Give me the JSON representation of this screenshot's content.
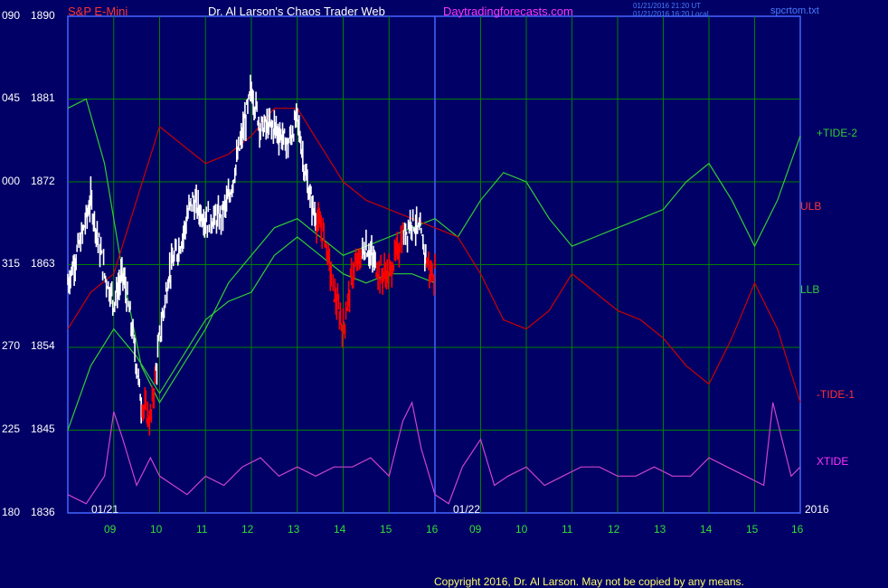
{
  "header": {
    "symbol": "S&P E-Mini",
    "author": "Dr. Al Larson's Chaos Trader Web",
    "site": "Daytradingforecasts.com",
    "stamp_ut": "01/21/2016 21:20 UT",
    "stamp_local": "01/21/2016 16:20 Local",
    "file": "spcrtom.txt"
  },
  "footer": {
    "copyright": "Copyright 2016, Dr. Al Larson. May not be copied by any means."
  },
  "colors": {
    "background": "#000066",
    "grid": "#008000",
    "frame": "#4466ff",
    "price": "#ffffff",
    "price_down": "#ff0000",
    "tide2": "#33cc33",
    "bands": "#cc0000",
    "xtide": "#cc44cc",
    "ma_fast": "#ffff66",
    "ma_mid": "#33ccff",
    "ma_slow": "#33cc33"
  },
  "chart_data": {
    "type": "line",
    "title": "S&P E-Mini",
    "y_left_ticks": [
      "090",
      "045",
      "000",
      "315",
      "270",
      "225",
      "180"
    ],
    "y_right_ticks": [
      1890,
      1881,
      1872,
      1863,
      1854,
      1845,
      1836
    ],
    "ylim": [
      1836,
      1890
    ],
    "x_hours_day1": [
      "09",
      "10",
      "11",
      "12",
      "13",
      "14",
      "15",
      "16"
    ],
    "x_hours_day2": [
      "09",
      "10",
      "11",
      "12",
      "13",
      "14",
      "15",
      "16"
    ],
    "date_labels": [
      "01/21",
      "01/22",
      "2016"
    ],
    "xlim": [
      8.0,
      16.0,
      24.0
    ],
    "series_labels": [
      "+TIDE-2",
      "ULB",
      "LLB",
      "-TIDE-1",
      "XTIDE"
    ],
    "series": [
      {
        "name": "+TIDE-2",
        "x": [
          8.0,
          8.4,
          8.8,
          9.2,
          9.6,
          10.0,
          10.5,
          11.0,
          11.5,
          12.0,
          12.5,
          13.0,
          13.5,
          14.0,
          14.5,
          15.0,
          15.5,
          16.0,
          16.5,
          17.0,
          17.5,
          18.0,
          18.5,
          19.0,
          19.5,
          20.0,
          20.5,
          21.0,
          21.5,
          22.0,
          22.5,
          23.0,
          23.5,
          24.0
        ],
        "y": [
          1880,
          1881,
          1874,
          1862,
          1852,
          1848,
          1852,
          1856,
          1861,
          1864,
          1867,
          1868,
          1866,
          1864,
          1865,
          1866,
          1867,
          1868,
          1866,
          1870,
          1873,
          1872,
          1868,
          1865,
          1866,
          1867,
          1868,
          1869,
          1872,
          1874,
          1870,
          1865,
          1870,
          1877
        ]
      },
      {
        "name": "ULB",
        "x": [
          8.0,
          8.5,
          9.0,
          9.5,
          10.0,
          10.5,
          11.0,
          11.5,
          12.0,
          12.5,
          13.0,
          13.5,
          14.0,
          14.5,
          15.0,
          15.5,
          16.0,
          16.5,
          17.0,
          17.5,
          18.0,
          18.5,
          19.0,
          19.5,
          20.0,
          20.5,
          21.0,
          21.5,
          22.0,
          22.5,
          23.0,
          23.5,
          24.0
        ],
        "y": [
          1856,
          1860,
          1862,
          1870,
          1878,
          1876,
          1874,
          1875,
          1877,
          1880,
          1880,
          1876,
          1872,
          1870,
          1869,
          1868,
          1867,
          1866,
          1862,
          1857,
          1856,
          1858,
          1862,
          1860,
          1858,
          1857,
          1855,
          1852,
          1850,
          1855,
          1861,
          1856,
          1848
        ]
      },
      {
        "name": "LLB",
        "x": [
          8.0,
          8.5,
          9.0,
          9.5,
          10.0,
          10.5,
          11.0,
          11.5,
          12.0,
          12.5,
          13.0,
          13.5,
          14.0,
          14.5,
          15.0,
          15.5,
          16.0
        ],
        "y": [
          1845,
          1852,
          1856,
          1853,
          1849,
          1853,
          1857,
          1859,
          1860,
          1864,
          1866,
          1864,
          1862,
          1861,
          1862,
          1862,
          1861
        ]
      },
      {
        "name": "XTIDE",
        "x": [
          8.0,
          8.4,
          8.8,
          9.0,
          9.2,
          9.5,
          9.8,
          10.0,
          10.3,
          10.6,
          11.0,
          11.4,
          11.8,
          12.2,
          12.6,
          13.0,
          13.4,
          13.8,
          14.2,
          14.6,
          15.0,
          15.3,
          15.5,
          15.7,
          16.0,
          16.3,
          16.6,
          17.0,
          17.3,
          17.6,
          18.0,
          18.4,
          18.8,
          19.2,
          19.6,
          20.0,
          20.4,
          20.8,
          21.2,
          21.6,
          22.0,
          22.4,
          22.8,
          23.2,
          23.4,
          23.6,
          23.8,
          24.0
        ],
        "y": [
          1838,
          1837,
          1840,
          1847,
          1844,
          1839,
          1842,
          1840,
          1839,
          1838,
          1840,
          1839,
          1841,
          1842,
          1840,
          1841,
          1840,
          1841,
          1841,
          1842,
          1840,
          1846,
          1848,
          1843,
          1838,
          1837,
          1841,
          1844,
          1839,
          1840,
          1841,
          1839,
          1840,
          1841,
          1841,
          1840,
          1840,
          1841,
          1840,
          1840,
          1842,
          1841,
          1840,
          1839,
          1848,
          1844,
          1840,
          1841
        ]
      }
    ]
  }
}
